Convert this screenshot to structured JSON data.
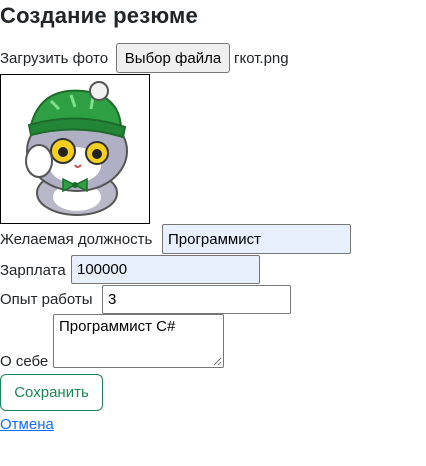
{
  "page": {
    "title": "Создание резюме"
  },
  "photo": {
    "label": "Загрузить фото",
    "button_label": "Выбор файла",
    "file_name": "гкот.png",
    "image_icon": "cat-sticker-with-green-hat"
  },
  "fields": {
    "position": {
      "label": "Желаемая должность",
      "value": "Программист"
    },
    "salary": {
      "label": "Зарплата",
      "value": "100000"
    },
    "experience": {
      "label": "Опыт работы",
      "value": "3"
    },
    "about": {
      "label": "О себе",
      "value": "Программист C#"
    }
  },
  "actions": {
    "save_label": "Сохранить",
    "cancel_label": "Отмена"
  },
  "colors": {
    "accent_green": "#198754",
    "link_blue": "#0d6efd",
    "autofill_bg": "#e8f0fe"
  }
}
